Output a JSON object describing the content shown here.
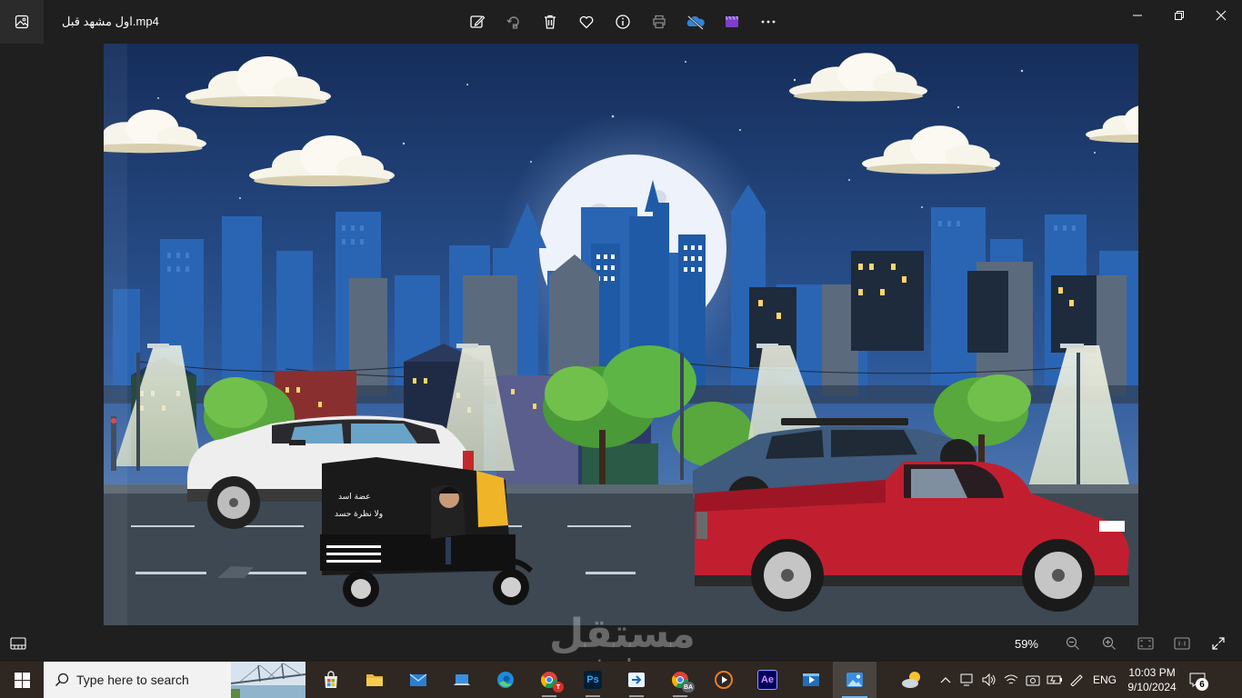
{
  "window": {
    "file_name": "اول مشهد قبل.mp4"
  },
  "toolbar": {
    "buttons": [
      {
        "name": "edit-image-icon"
      },
      {
        "name": "rotate-icon"
      },
      {
        "name": "delete-icon"
      },
      {
        "name": "favorite-icon"
      },
      {
        "name": "file-info-icon"
      },
      {
        "name": "print-icon"
      },
      {
        "name": "onedrive-icon"
      },
      {
        "name": "video-editor-icon"
      },
      {
        "name": "more-options-icon"
      }
    ]
  },
  "scene": {
    "tuktuk_text_line1": "عضة اسد",
    "tuktuk_text_line2": "ولا نظرة حسد"
  },
  "bottom": {
    "zoom_level": "59%"
  },
  "watermark": {
    "logo": "مستقل",
    "url": "mostaql.com"
  },
  "taskbar": {
    "search_placeholder": "Type here to search",
    "apps": [
      {
        "name": "microsoft-store",
        "running": false
      },
      {
        "name": "file-explorer",
        "running": false
      },
      {
        "name": "mail",
        "running": false
      },
      {
        "name": "laptop-app",
        "running": false
      },
      {
        "name": "edge",
        "running": false
      },
      {
        "name": "chrome-profile-t",
        "badge": "T",
        "running": true
      },
      {
        "name": "photoshop",
        "label": "Ps",
        "running": true
      },
      {
        "name": "forward-app",
        "running": true
      },
      {
        "name": "chrome-profile-ba",
        "badge": "BA",
        "running": true
      },
      {
        "name": "media-player",
        "running": false
      },
      {
        "name": "after-effects",
        "label": "Ae",
        "running": false
      },
      {
        "name": "movie-editor",
        "running": false
      },
      {
        "name": "photos",
        "running": true,
        "active": true
      }
    ],
    "language": "ENG",
    "time": "10:03 PM",
    "date": "9/10/2024",
    "notification_count": "6"
  },
  "colors": {
    "sky_top": "#152d5a",
    "sky_bottom": "#4a78b8",
    "road": "#3d4853",
    "pickup_red": "#c11f30",
    "taskbar": "#2f2722",
    "title_bg": "#1f1f1f"
  }
}
